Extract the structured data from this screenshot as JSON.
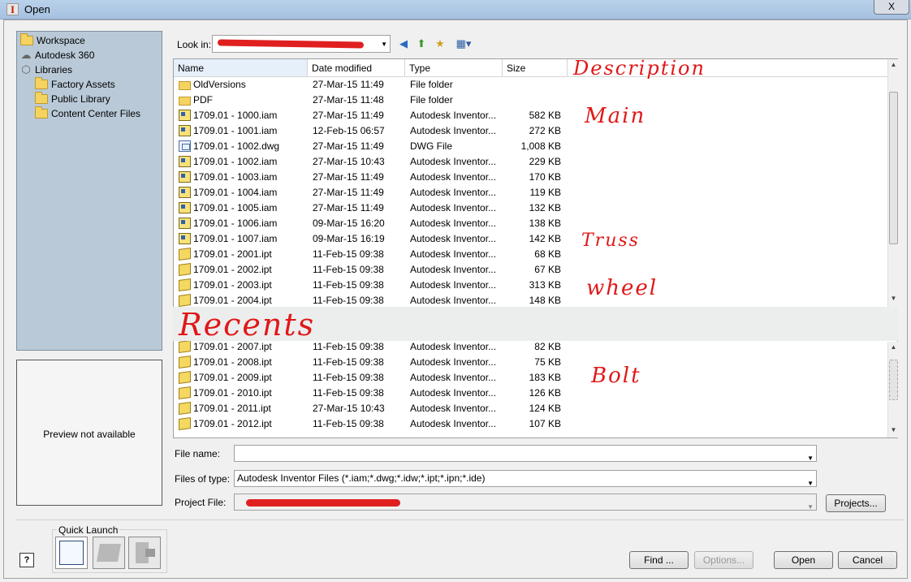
{
  "window": {
    "title": "Open",
    "app_icon_letter": "I",
    "close_label": "X"
  },
  "places": [
    {
      "label": "Workspace",
      "icon": "folder-icon"
    },
    {
      "label": "Autodesk 360",
      "icon": "cloud-icon"
    },
    {
      "label": "Libraries",
      "icon": "library-icon"
    },
    {
      "label": "Factory Assets",
      "icon": "folder-icon"
    },
    {
      "label": "Public Library",
      "icon": "folder-icon"
    },
    {
      "label": "Content Center Files",
      "icon": "folder-icon"
    }
  ],
  "preview": {
    "text": "Preview not available"
  },
  "lookin": {
    "label": "Look in:"
  },
  "columns": {
    "name": "Name",
    "date": "Date modified",
    "type": "Type",
    "size": "Size"
  },
  "files": [
    {
      "name": "OldVersions",
      "date": "27-Mar-15 11:49",
      "type": "File folder",
      "size": "",
      "icon": "folder"
    },
    {
      "name": "PDF",
      "date": "27-Mar-15 11:48",
      "type": "File folder",
      "size": "",
      "icon": "folder"
    },
    {
      "name": "1709.01 - 1000.iam",
      "date": "27-Mar-15 11:49",
      "type": "Autodesk Inventor...",
      "size": "582 KB",
      "icon": "iam"
    },
    {
      "name": "1709.01 - 1001.iam",
      "date": "12-Feb-15 06:57",
      "type": "Autodesk Inventor...",
      "size": "272 KB",
      "icon": "iam"
    },
    {
      "name": "1709.01 - 1002.dwg",
      "date": "27-Mar-15 11:49",
      "type": "DWG File",
      "size": "1,008 KB",
      "icon": "dwg"
    },
    {
      "name": "1709.01 - 1002.iam",
      "date": "27-Mar-15 10:43",
      "type": "Autodesk Inventor...",
      "size": "229 KB",
      "icon": "iam"
    },
    {
      "name": "1709.01 - 1003.iam",
      "date": "27-Mar-15 11:49",
      "type": "Autodesk Inventor...",
      "size": "170 KB",
      "icon": "iam"
    },
    {
      "name": "1709.01 - 1004.iam",
      "date": "27-Mar-15 11:49",
      "type": "Autodesk Inventor...",
      "size": "119 KB",
      "icon": "iam"
    },
    {
      "name": "1709.01 - 1005.iam",
      "date": "27-Mar-15 11:49",
      "type": "Autodesk Inventor...",
      "size": "132 KB",
      "icon": "iam"
    },
    {
      "name": "1709.01 - 1006.iam",
      "date": "09-Mar-15 16:20",
      "type": "Autodesk Inventor...",
      "size": "138 KB",
      "icon": "iam"
    },
    {
      "name": "1709.01 - 1007.iam",
      "date": "09-Mar-15 16:19",
      "type": "Autodesk Inventor...",
      "size": "142 KB",
      "icon": "iam"
    },
    {
      "name": "1709.01 - 2001.ipt",
      "date": "11-Feb-15 09:38",
      "type": "Autodesk Inventor...",
      "size": "68 KB",
      "icon": "ipt"
    },
    {
      "name": "1709.01 - 2002.ipt",
      "date": "11-Feb-15 09:38",
      "type": "Autodesk Inventor...",
      "size": "67 KB",
      "icon": "ipt"
    },
    {
      "name": "1709.01 - 2003.ipt",
      "date": "11-Feb-15 09:38",
      "type": "Autodesk Inventor...",
      "size": "313 KB",
      "icon": "ipt"
    },
    {
      "name": "1709.01 - 2004.ipt",
      "date": "11-Feb-15 09:38",
      "type": "Autodesk Inventor...",
      "size": "148 KB",
      "icon": "ipt"
    }
  ],
  "files2": [
    {
      "name": "1709.01 - 2007.ipt",
      "date": "11-Feb-15 09:38",
      "type": "Autodesk Inventor...",
      "size": "82 KB",
      "icon": "ipt"
    },
    {
      "name": "1709.01 - 2008.ipt",
      "date": "11-Feb-15 09:38",
      "type": "Autodesk Inventor...",
      "size": "75 KB",
      "icon": "ipt"
    },
    {
      "name": "1709.01 - 2009.ipt",
      "date": "11-Feb-15 09:38",
      "type": "Autodesk Inventor...",
      "size": "183 KB",
      "icon": "ipt"
    },
    {
      "name": "1709.01 - 2010.ipt",
      "date": "11-Feb-15 09:38",
      "type": "Autodesk Inventor...",
      "size": "126 KB",
      "icon": "ipt"
    },
    {
      "name": "1709.01 - 2011.ipt",
      "date": "27-Mar-15 10:43",
      "type": "Autodesk Inventor...",
      "size": "124 KB",
      "icon": "ipt"
    },
    {
      "name": "1709.01 - 2012.ipt",
      "date": "11-Feb-15 09:38",
      "type": "Autodesk Inventor...",
      "size": "107 KB",
      "icon": "ipt"
    }
  ],
  "annotations": {
    "description": "Description",
    "main": "Main",
    "truss": "Truss",
    "wheel": "wheel",
    "recents": "Recents",
    "bolt": "Bolt"
  },
  "form": {
    "file_name_label": "File name:",
    "file_name_value": "",
    "files_of_type_label": "Files of type:",
    "files_of_type_value": "Autodesk Inventor Files (*.iam;*.dwg;*.idw;*.ipt;*.ipn;*.ide)",
    "project_file_label": "Project File:"
  },
  "buttons": {
    "projects": "Projects...",
    "find": "Find ...",
    "options": "Options...",
    "open": "Open",
    "cancel": "Cancel"
  },
  "quick_launch": {
    "label": "Quick Launch"
  },
  "help": {
    "label": "?"
  }
}
